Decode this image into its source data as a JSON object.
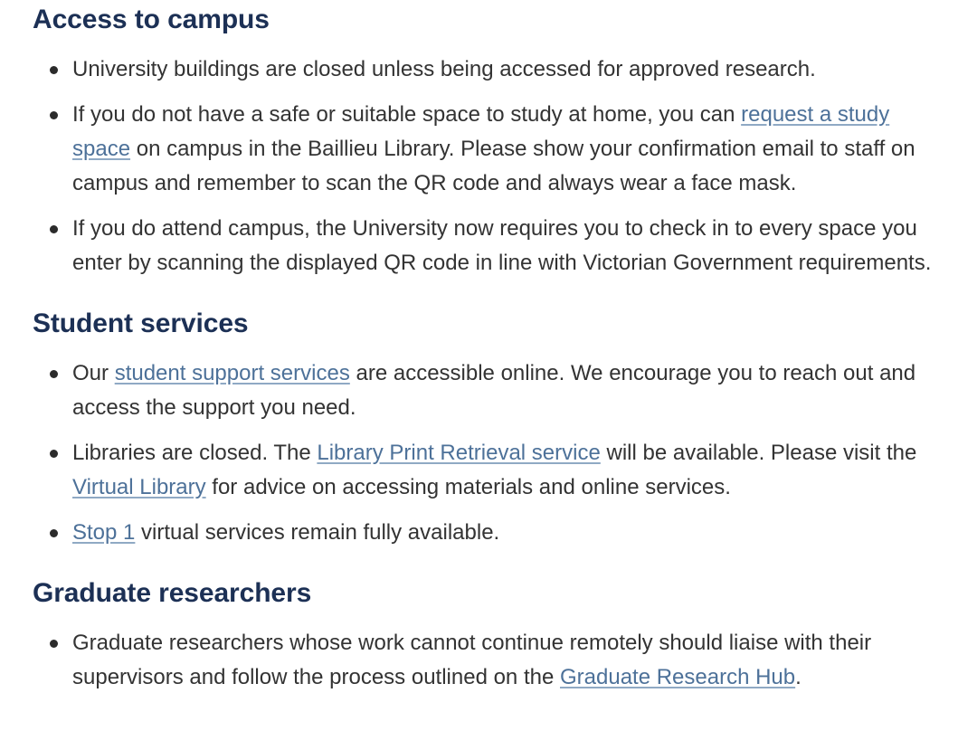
{
  "colors": {
    "heading": "#1c3055",
    "body_text": "#333333",
    "link": "#4d7199",
    "link_underline": "#8fa9c4",
    "bullet_marker": "#2b2b2b",
    "background": "#ffffff"
  },
  "sections": [
    {
      "heading": "Access to campus",
      "bullets": [
        {
          "parts": [
            {
              "type": "text",
              "content": "University buildings are closed unless being accessed for approved research."
            }
          ]
        },
        {
          "parts": [
            {
              "type": "text",
              "content": "If you do not have a safe or suitable space to study at home, you can "
            },
            {
              "type": "link",
              "content": "request a study space"
            },
            {
              "type": "text",
              "content": " on campus in the Baillieu Library. Please show your confirmation email to staff on campus and remember to scan the QR code and always wear a face mask."
            }
          ]
        },
        {
          "parts": [
            {
              "type": "text",
              "content": "If you do attend campus, the University now requires you to check in to every space you enter by scanning the displayed QR code in line with Victorian Government requirements."
            }
          ]
        }
      ]
    },
    {
      "heading": "Student services",
      "bullets": [
        {
          "parts": [
            {
              "type": "text",
              "content": "Our "
            },
            {
              "type": "link",
              "content": "student support services"
            },
            {
              "type": "text",
              "content": " are accessible online. We encourage you to reach out and access the support you need."
            }
          ]
        },
        {
          "parts": [
            {
              "type": "text",
              "content": "Libraries are closed. The "
            },
            {
              "type": "link",
              "content": "Library Print Retrieval service"
            },
            {
              "type": "text",
              "content": " will be available. Please visit the "
            },
            {
              "type": "link",
              "content": "Virtual Library"
            },
            {
              "type": "text",
              "content": " for advice on accessing materials and online services."
            }
          ]
        },
        {
          "parts": [
            {
              "type": "link",
              "content": "Stop 1"
            },
            {
              "type": "text",
              "content": " virtual services remain fully available."
            }
          ]
        }
      ]
    },
    {
      "heading": "Graduate researchers",
      "bullets": [
        {
          "parts": [
            {
              "type": "text",
              "content": "Graduate researchers whose work cannot continue remotely should liaise with their supervisors and follow the process outlined on the "
            },
            {
              "type": "link",
              "content": "Graduate Research Hub"
            },
            {
              "type": "text",
              "content": "."
            }
          ]
        }
      ]
    }
  ]
}
